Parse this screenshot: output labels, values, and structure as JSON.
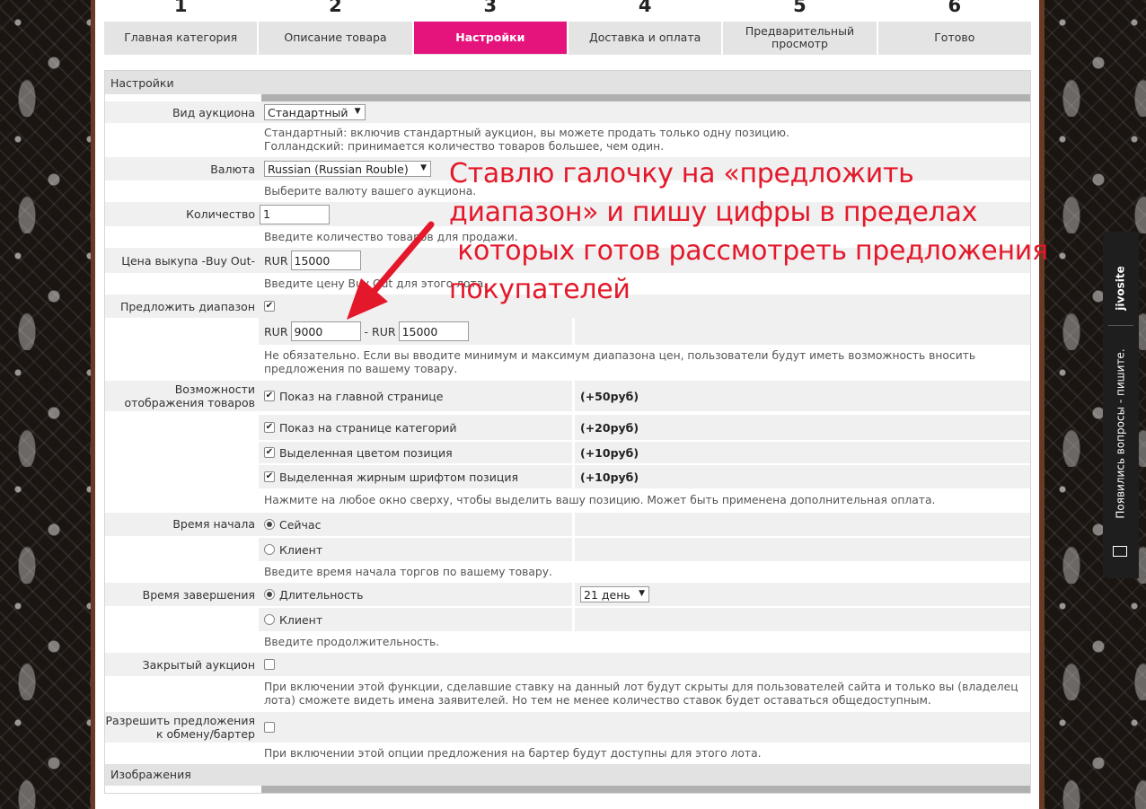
{
  "steps": [
    {
      "num": "1",
      "label": "Главная категория"
    },
    {
      "num": "2",
      "label": "Описание товара"
    },
    {
      "num": "3",
      "label": "Настройки",
      "active": true
    },
    {
      "num": "4",
      "label": "Доставка и оплата"
    },
    {
      "num": "5",
      "label": "Предварительный просмотр"
    },
    {
      "num": "6",
      "label": "Готово"
    }
  ],
  "settings": {
    "title": "Настройки",
    "auction_type": {
      "label": "Вид аукциона",
      "value": "Стандартный",
      "hint1": "Стандартный: включив стандартный аукцион, вы можете продать только одну позицию.",
      "hint2": "Голландский: принимается количество товаров большее, чем один."
    },
    "currency": {
      "label": "Валюта",
      "value": "Russian (Russian Rouble)",
      "hint": "Выберите валюту вашего аукциона."
    },
    "quantity": {
      "label": "Количество",
      "value": "1",
      "hint": "Введите количество товаров для продажи."
    },
    "buyout": {
      "label": "Цена выкупа -Buy Out-",
      "currency": "RUR",
      "value": "15000",
      "hint": "Введите цену Buy Out для этого лота."
    },
    "offer_range": {
      "label": "Предложить диапазон",
      "checked": true,
      "min_currency": "RUR",
      "min": "9000",
      "dash": "-",
      "max_currency": "RUR",
      "max": "15000",
      "hint": "Не обязательно. Если вы вводите минимум и максимум диапазона цен, пользователи будут иметь возможность вносить предложения по вашему товару."
    },
    "display": {
      "label": "Возможности отображения товаров",
      "options": [
        {
          "label": "Показ на главной странице",
          "price": "(+50руб)",
          "checked": true
        },
        {
          "label": "Показ на странице категорий",
          "price": "(+20руб)",
          "checked": true
        },
        {
          "label": "Выделенная цветом позиция",
          "price": "(+10руб)",
          "checked": true
        },
        {
          "label": "Выделенная жирным шрифтом позиция",
          "price": "(+10руб)",
          "checked": true
        }
      ],
      "hint": "Нажмите на любое окно сверху, чтобы выделить вашу позицию. Может быть применена дополнительная оплата."
    },
    "start_time": {
      "label": "Время начала",
      "opt1": "Сейчас",
      "opt2": "Клиент",
      "hint": "Введите время начала торгов по вашему товару."
    },
    "end_time": {
      "label": "Время завершения",
      "opt1": "Длительность",
      "duration": "21 день",
      "opt2": "Клиент",
      "hint": "Введите продолжительность."
    },
    "closed": {
      "label": "Закрытый аукцион",
      "checked": false,
      "hint": "При включении этой функции, сделавшие ставку на данный лот будут скрыты для пользователей сайта и только вы (владелец лота) сможете видеть имена заявителей. Но тем не менее количество ставок будет оставаться общедоступным."
    },
    "barter": {
      "label": "Разрешить предложения к обмену/бартер",
      "checked": false,
      "hint": "При включении этой опции предложения на бартер будут доступны для этого лота."
    }
  },
  "images": {
    "title": "Изображения"
  },
  "annotation": {
    "lines": [
      "Ставлю галочку на «предложить",
      "диапазон» и пишу цифры в пределах",
      " которых готов рассмотреть предложения",
      "покупателей"
    ],
    "color": "#e3192b"
  },
  "widget": {
    "brand": "jivosite",
    "message": "Появились вопросы - пишите."
  },
  "colors": {
    "accent": "#e5147c",
    "frame": "#6a3a24"
  }
}
